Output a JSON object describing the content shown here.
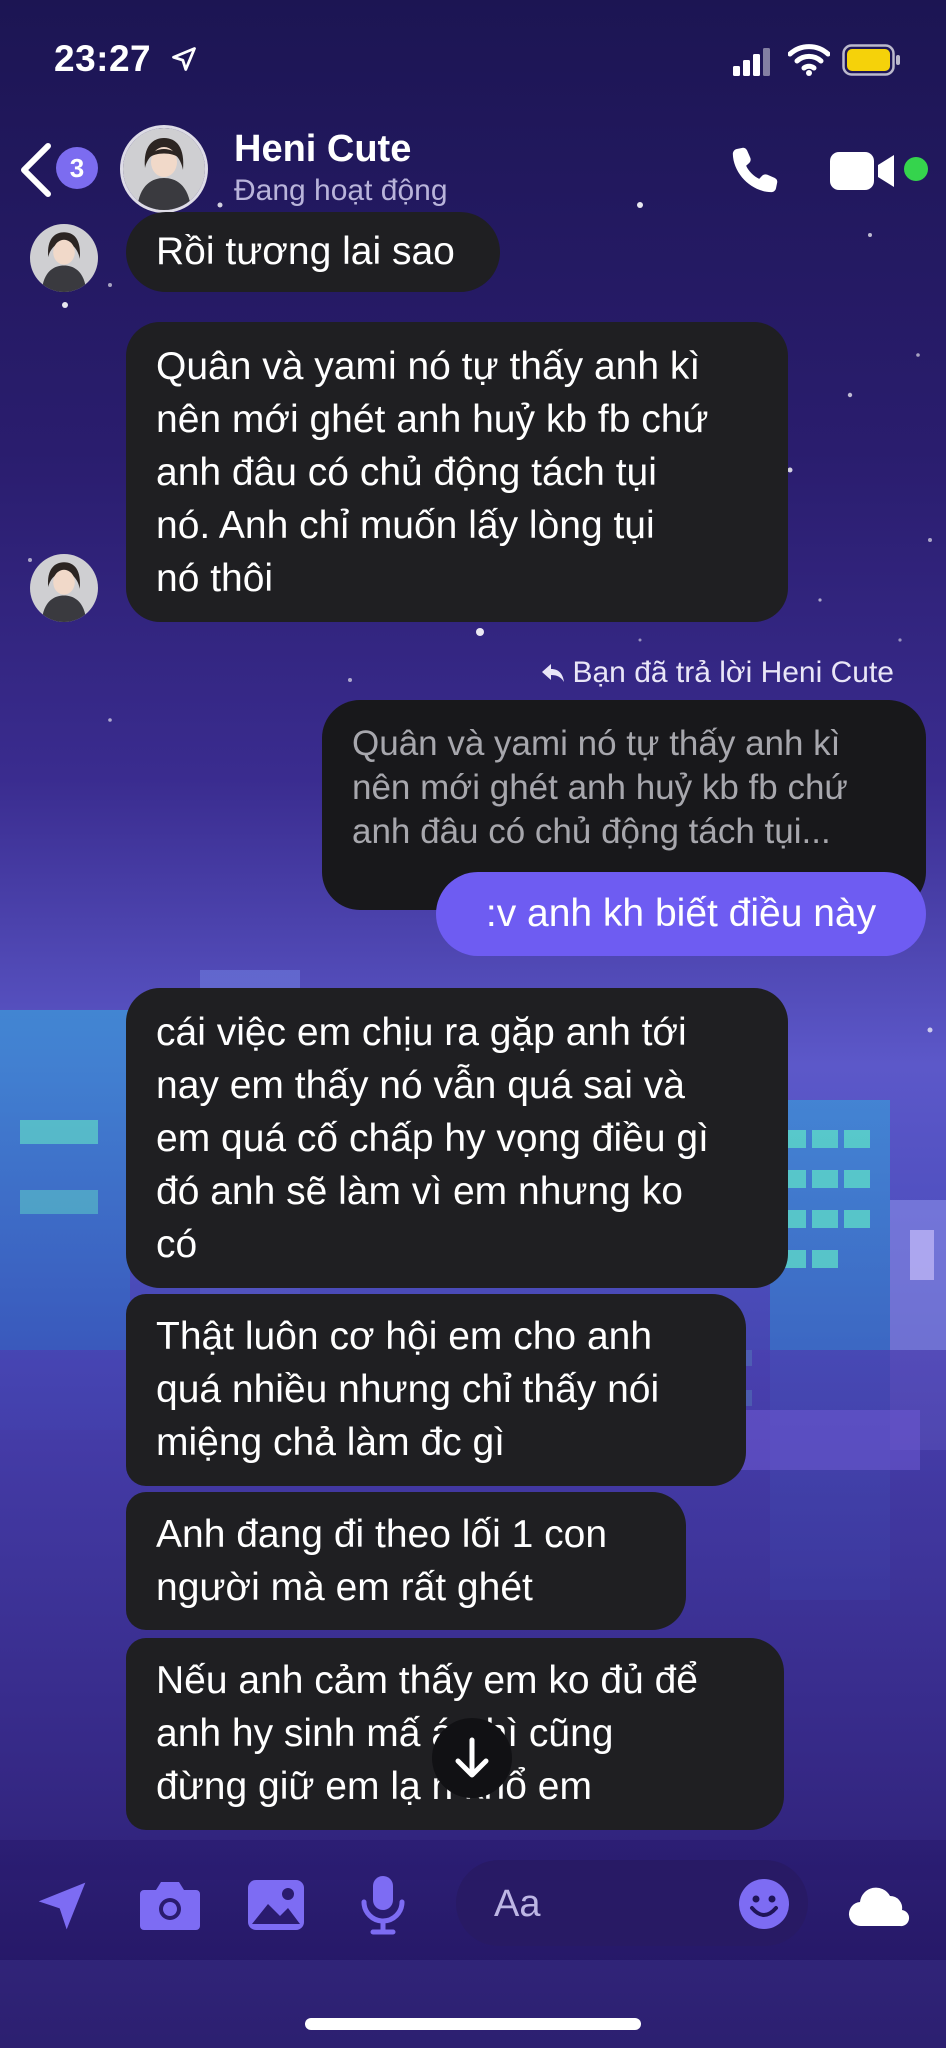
{
  "status_bar": {
    "time": "23:27"
  },
  "header": {
    "back_count": "3",
    "contact_name": "Heni Cute",
    "contact_status": "Đang hoạt động"
  },
  "messages": [
    {
      "sender": "Heni Cute",
      "text": "Rồi tương lai sao"
    },
    {
      "sender": "Heni Cute",
      "text": "Quân và yami nó tự thấy anh kì\nnên mới ghét anh huỷ kb fb chứ\nanh đâu có chủ động tách tụi\nnó. Anh chỉ muốn lấy lòng tụi\nnó thôi"
    },
    {
      "sender": "me",
      "reply_note": "Bạn đã trả lời Heni Cute",
      "quoted_text": "Quân và yami nó tự thấy anh kì\nnên mới ghét anh huỷ kb fb chứ\nanh đâu có chủ động tách tụi...",
      "text": ":v anh kh biết điều này"
    },
    {
      "sender": "Heni Cute",
      "text": "cái việc em chịu ra gặp anh tới\nnay em thấy nó vẫn quá sai và\nem quá cố chấp hy vọng điều gì\nđó anh sẽ làm vì em nhưng ko\ncó"
    },
    {
      "sender": "Heni Cute",
      "text": "Thật luôn cơ hội em cho anh\nquá nhiều nhưng chỉ thấy nói\nmiệng chả làm đc gì"
    },
    {
      "sender": "Heni Cute",
      "text": "Anh đang đi theo lối 1 con\nngười mà em rất ghét"
    },
    {
      "sender": "Heni Cute",
      "text": "Nếu anh cảm thấy em ko đủ để\nanh hy sinh mấ    át thì cũng\nđừng giữ em lạ    n khổ em"
    }
  ],
  "composer": {
    "placeholder": "Aa"
  },
  "colors": {
    "accent": "#6e5cf2",
    "bubble_bg": "#1f1f22",
    "online": "#35d44d",
    "battery": "#f5d20a"
  },
  "icons": [
    "location-arrow-icon",
    "signal-icon",
    "wifi-icon",
    "battery-icon",
    "back-chevron-icon",
    "phone-icon",
    "video-camera-icon",
    "send-arrow-icon",
    "camera-icon",
    "gallery-icon",
    "microphone-icon",
    "emoji-icon",
    "cloud-icon",
    "arrow-down-icon",
    "reply-arrow-icon"
  ]
}
